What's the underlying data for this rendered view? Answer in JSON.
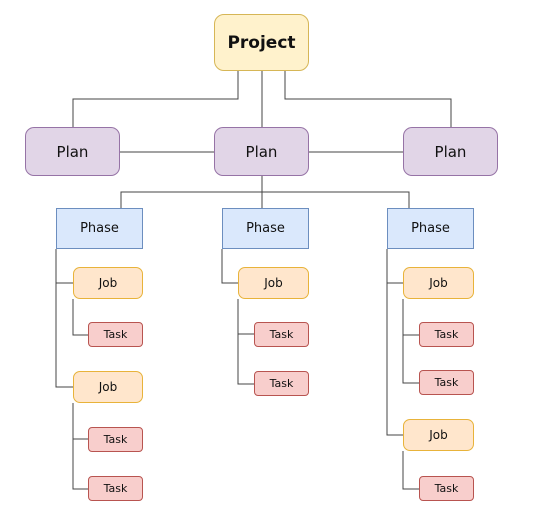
{
  "diagram": {
    "root": {
      "label": "Project",
      "fill": "#fff2cc",
      "stroke": "#d6b656"
    },
    "plans": [
      {
        "label": "Plan"
      },
      {
        "label": "Plan"
      },
      {
        "label": "Plan"
      }
    ],
    "phases": [
      {
        "label": "Phase",
        "jobs": [
          {
            "label": "Job",
            "tasks": [
              {
                "label": "Task"
              }
            ]
          },
          {
            "label": "Job",
            "tasks": [
              {
                "label": "Task"
              },
              {
                "label": "Task"
              }
            ]
          }
        ]
      },
      {
        "label": "Phase",
        "jobs": [
          {
            "label": "Job",
            "tasks": [
              {
                "label": "Task"
              },
              {
                "label": "Task"
              }
            ]
          }
        ]
      },
      {
        "label": "Phase",
        "jobs": [
          {
            "label": "Job",
            "tasks": [
              {
                "label": "Task"
              },
              {
                "label": "Task"
              }
            ]
          },
          {
            "label": "Job",
            "tasks": [
              {
                "label": "Task"
              }
            ]
          }
        ]
      }
    ],
    "colors": {
      "plan": "#e1d5e7",
      "phase": "#dae8fc",
      "job": "#ffe6cc",
      "task": "#f8cecc",
      "connector": "#444444"
    }
  }
}
